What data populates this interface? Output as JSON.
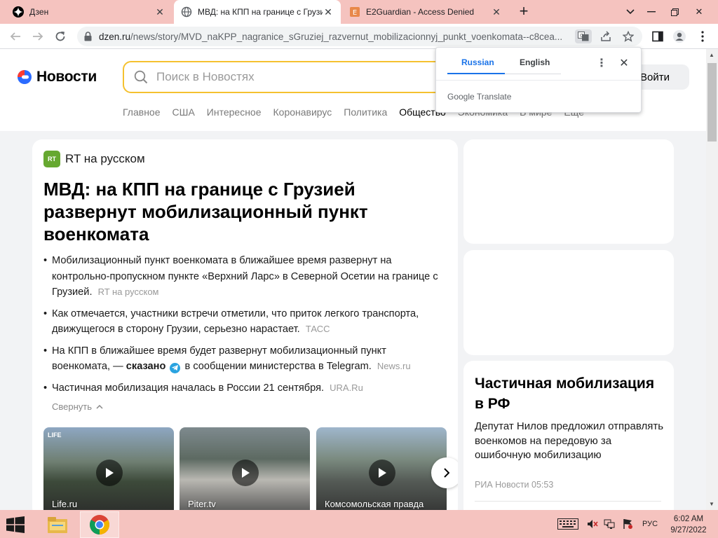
{
  "browser": {
    "tabs": [
      {
        "title": "Дзен",
        "favicon": "dzen-icon",
        "active": false
      },
      {
        "title": "МВД: на КПП на границе с Грузией",
        "favicon": "globe-icon",
        "active": true
      },
      {
        "title": "E2Guardian - Access Denied",
        "favicon": "e2guardian-icon",
        "active": false
      }
    ],
    "url_domain": "dzen.ru",
    "url_path": "/news/story/MVD_naKPP_nagranice_sGruziej_razvernut_mobilizacionnyj_punkt_voenkomata--c8cea..."
  },
  "translate_popup": {
    "tabs": [
      "Russian",
      "English"
    ],
    "selected": "Russian",
    "footer_brand": "Google",
    "footer_product": "Translate"
  },
  "header": {
    "logo_text": "Новости",
    "search_placeholder": "Поиск в Новостях",
    "login_label": "Войти",
    "nav": [
      "Главное",
      "США",
      "Интересное",
      "Коронавирус",
      "Политика",
      "Общество",
      "Экономика",
      "В мире",
      "Ещё"
    ],
    "nav_active": "Общество"
  },
  "article": {
    "source_logo": "RT",
    "source_name": "RT на русском",
    "headline": "МВД: на КПП на границе с Грузией развернут мобилизационный пункт военкомата",
    "bullets": [
      {
        "text": "Мобилизационный пункт военкомата в ближайшее время развернут на контрольно-пропускном пункте «Верхний Ларс» в Северной Осетии на границе с Грузией.",
        "source": "RT на русском"
      },
      {
        "text": "Как отмечается, участники встречи отметили, что приток легкого транспорта, движущегося в сторону Грузии, серьезно нарастает.",
        "source": "ТАСС"
      },
      {
        "text_before": "На КПП в ближайшее время будет развернут мобилизационный пункт военкомата, —",
        "link": "сказано",
        "text_after": "в сообщении министерства в Telegram.",
        "source": "News.ru"
      },
      {
        "text": "Частичная мобилизация началась в России 21 сентября.",
        "source": "URA.Ru"
      }
    ],
    "collapse_label": "Свернуть",
    "videos": [
      {
        "caption": "Life.ru",
        "badge": "LIFE"
      },
      {
        "caption": "Piter.tv",
        "badge": ""
      },
      {
        "caption": "Комсомольская правда",
        "badge": ""
      }
    ]
  },
  "sidebar": {
    "title": "Частичная мобилизация в РФ",
    "story": "Депутат Нилов предложил отправлять военкомов на передовую за ошибочную мобилизацию",
    "meta": "РИА Новости 05:53"
  },
  "taskbar": {
    "lang": "РУС",
    "time": "6:02 AM",
    "date": "9/27/2022"
  },
  "colors": {
    "chrome_accent": "#f5c3bf",
    "search_border": "#f5c12f",
    "translate_blue": "#1a73e8",
    "rt_green": "#66a830"
  }
}
